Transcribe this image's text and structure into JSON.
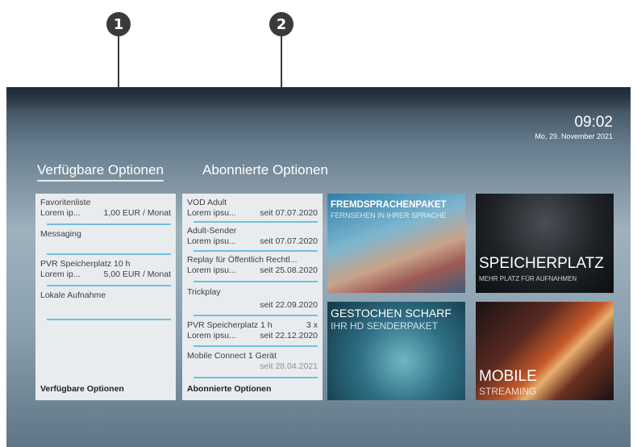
{
  "markers": [
    "1",
    "2"
  ],
  "clock": {
    "time": "09:02",
    "date": "Mo, 29. November 2021"
  },
  "tabs": [
    {
      "label": "Verfügbare Optionen",
      "active": true
    },
    {
      "label": "Abonnierte Optionen",
      "active": false
    }
  ],
  "available": {
    "items": [
      {
        "name": "Favoritenliste",
        "desc": "Lorem ip...",
        "price": "1,00 EUR / Monat"
      },
      {
        "name": "Messaging"
      },
      {
        "name": "PVR Speicherplatz 10 h",
        "desc": "Lorem ip...",
        "price": "5,00 EUR / Monat"
      },
      {
        "name": "Lokale Aufnahme"
      }
    ],
    "footer": "Verfügbare Optionen"
  },
  "subscribed": {
    "items": [
      {
        "name": "VOD Adult",
        "desc": "Lorem ipsu...",
        "date": "seit 07.07.2020"
      },
      {
        "name": "Adult-Sender",
        "desc": "Lorem ipsu...",
        "date": "seit 07.07.2020"
      },
      {
        "name": "Replay für Öffentlich Rechtl...",
        "desc": "Lorem ipsu...",
        "date": "seit 25.08.2020"
      },
      {
        "name": "Trickplay",
        "date": "seit 22.09.2020"
      },
      {
        "name": "PVR Speicherplatz 1 h",
        "qty": "3 x",
        "desc": "Lorem ipsu...",
        "date": "seit 22.12.2020"
      },
      {
        "name": "Mobile Connect 1 Gerät",
        "date": "seit 28.04.2021"
      }
    ],
    "footer": "Abonnierte Optionen"
  },
  "tiles": [
    {
      "title": "FREMDSPRACHENPAKET",
      "subtitle": "FERNSEHEN IN IHRER SPRACHE"
    },
    {
      "title": "SPEICHERPLATZ",
      "subtitle": "MEHR PLATZ FÜR AUFNAHMEN"
    },
    {
      "title": "GESTOCHEN SCHARF",
      "subtitle": "IHR HD SENDERPAKET"
    },
    {
      "title": "MOBILE",
      "subtitle": "STREAMING"
    }
  ]
}
